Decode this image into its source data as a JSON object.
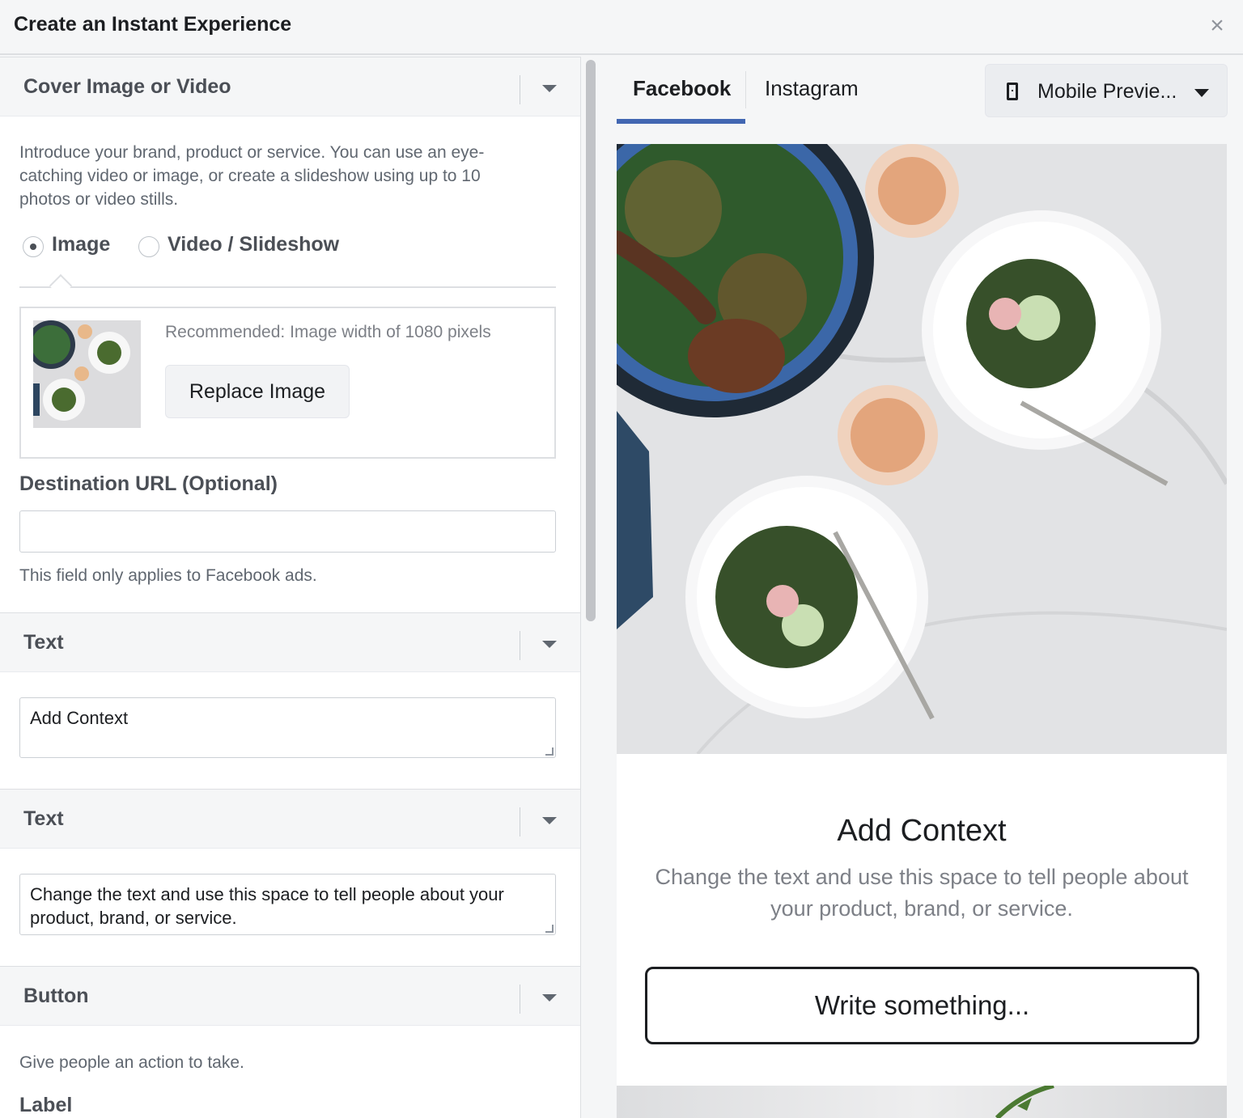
{
  "window": {
    "title": "Create an Instant Experience",
    "close_glyph": "×"
  },
  "cover_section": {
    "title": "Cover Image or Video",
    "description": "Introduce your brand, product or service. You can use an eye-catching video or image, or create a slideshow using up to 10 photos or video stills.",
    "media_options": [
      {
        "label": "Image",
        "selected": true
      },
      {
        "label": "Video / Slideshow",
        "selected": false
      }
    ],
    "recommendation": "Recommended: Image width of 1080 pixels",
    "replace_button": "Replace Image",
    "destination_label": "Destination URL (Optional)",
    "destination_value": "",
    "destination_help": "This field only applies to Facebook ads."
  },
  "text_section_1": {
    "title": "Text",
    "value": "Add Context"
  },
  "text_section_2": {
    "title": "Text",
    "value": "Change the text and use this space to tell people about your product, brand, or service."
  },
  "button_section": {
    "title": "Button",
    "description": "Give people an action to take.",
    "label_heading": "Label"
  },
  "preview": {
    "tabs": [
      {
        "label": "Facebook",
        "active": true
      },
      {
        "label": "Instagram",
        "active": false
      }
    ],
    "device_select": "Mobile Previe...",
    "context_title": "Add Context",
    "context_body": "Change the text and use this space to tell people about your product, brand, or service.",
    "cta_button": "Write something..."
  },
  "colors": {
    "accent": "#4267b2",
    "panel_bg": "#f5f6f7",
    "border": "#dddfe2"
  }
}
